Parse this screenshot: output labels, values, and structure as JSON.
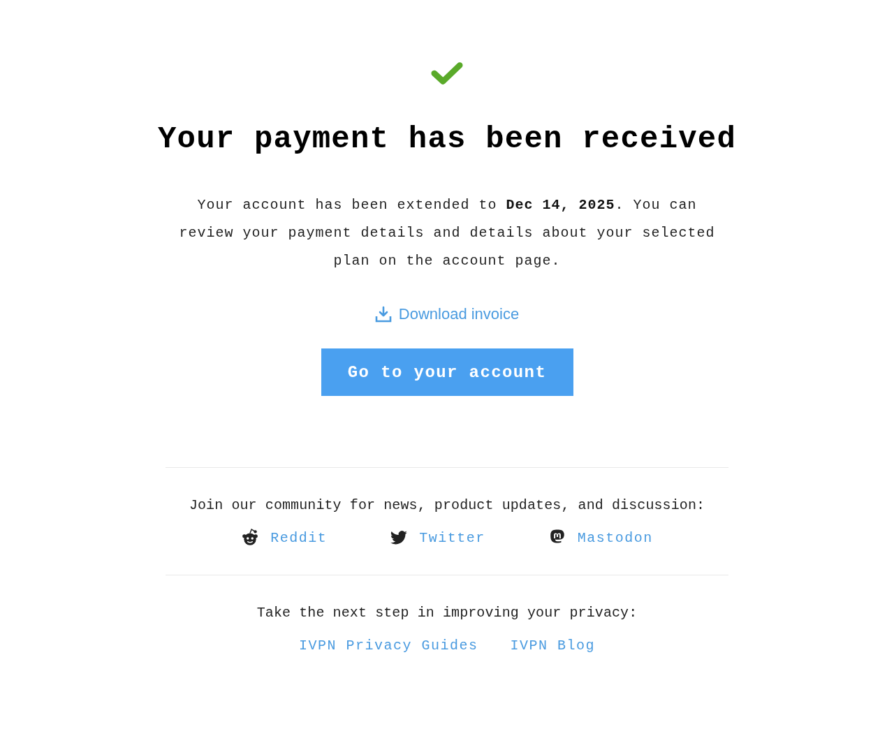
{
  "title": "Your payment has been received",
  "message": "Your account has been extended to **Dec 14, 2025**. You can review your payment details and details about your selected plan on the account page.",
  "download_link": {
    "label": "Download invoice"
  },
  "account_button": {
    "label": "Go to your account"
  },
  "community": {
    "text": "Join our community for news, product updates, and discussion:",
    "links": [
      {
        "kind": "reddit",
        "label": "Reddit"
      },
      {
        "kind": "twitter",
        "label": "Twitter"
      },
      {
        "kind": "mastodon",
        "label": "Mastodon"
      }
    ]
  },
  "next_step": {
    "text": "Take the next step in improving your privacy:",
    "links": [
      {
        "label": "IVPN Privacy Guides"
      },
      {
        "label": "IVPN Blog"
      }
    ]
  }
}
